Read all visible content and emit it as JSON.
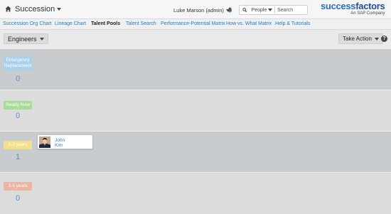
{
  "topbar": {
    "module": "Succession",
    "user": "Luke Marson (admin)",
    "search_scope": "People",
    "search_placeholder": "Search",
    "logo_main_1": "success",
    "logo_main_2": "factors",
    "logo_sub": "An SAP Company"
  },
  "nav": {
    "items": [
      {
        "label": "Succession Org Chart"
      },
      {
        "label": "Lineage Chart"
      },
      {
        "label": "Talent Pools"
      },
      {
        "label": "Talent Search"
      },
      {
        "label": "Performance-Potential Matrix"
      },
      {
        "label": "How vs. What Matrix"
      },
      {
        "label": "Help & Tutorials"
      }
    ],
    "active": "Talent Pools"
  },
  "toolbar": {
    "pool_select": "Engineers",
    "action_label": "Take Action",
    "help": "?"
  },
  "rows": [
    {
      "label": "Emergency Replacement",
      "count": "0",
      "color": "#a9d0ec"
    },
    {
      "label": "Ready Now",
      "count": "0",
      "color": "#a8dd97"
    },
    {
      "label": "1-2 years",
      "count": "1",
      "color": "#f4e08a",
      "card": {
        "first": "John",
        "last": "Kim"
      }
    },
    {
      "label": "3-5 years",
      "count": "0",
      "color": "#ecb4a3"
    }
  ],
  "colors": {
    "row_dark": "#c9ccce",
    "row_light": "#dcdcdc",
    "link": "#2b7bbf"
  }
}
